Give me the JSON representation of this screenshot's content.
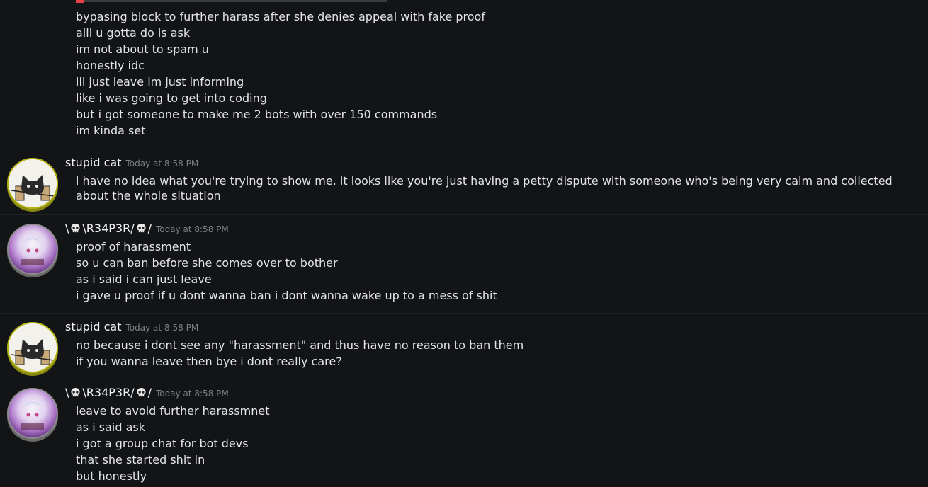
{
  "messages": [
    {
      "continuation": true,
      "lines": [
        "bypasing block to further harass after she denies appeal with fake proof",
        "alll u gotta do is ask",
        "im not about to spam u",
        "honestly idc",
        "ill just leave im just informing",
        "like i was going to get into coding",
        "but i got someone to make me 2 bots with over 150 commands",
        "im kinda set"
      ]
    },
    {
      "username": "stupid cat",
      "timestamp": "Today at 8:58 PM",
      "avatar": "cat-avatar",
      "lines": [
        "i have no idea what you're trying to show me. it looks like you're just having a petty dispute with someone who's being very calm and collected about the whole situation"
      ]
    },
    {
      "username_parts": [
        "\\",
        "\\R34P3R/",
        "/"
      ],
      "timestamp": "Today at 8:58 PM",
      "avatar": "reaper-avatar",
      "lines": [
        "proof of harassment",
        "so u can ban before she comes over to bother",
        "as i said i can just leave",
        "i gave u proof if u dont wanna ban i dont wanna wake up to a mess of shit"
      ]
    },
    {
      "username": "stupid cat",
      "timestamp": "Today at 8:58 PM",
      "avatar": "cat-avatar",
      "lines": [
        "no because i dont see any \"harassment\" and thus have no reason to ban them",
        "if you wanna leave then bye i dont really care?"
      ]
    },
    {
      "username_parts": [
        "\\",
        "\\R34P3R/",
        "/"
      ],
      "timestamp": "Today at 8:58 PM",
      "avatar": "reaper-avatar",
      "lines": [
        "leave to avoid further harassmnet",
        "as i said ask",
        "i got a group chat for bot devs",
        "that she started shit in",
        "but honestly"
      ]
    }
  ],
  "colors": {
    "background": "#131416",
    "text": "#e4e5e8",
    "username": "#f2f3f5",
    "timestamp": "#7d8087",
    "cat_avatar_border": "#b4b312"
  }
}
